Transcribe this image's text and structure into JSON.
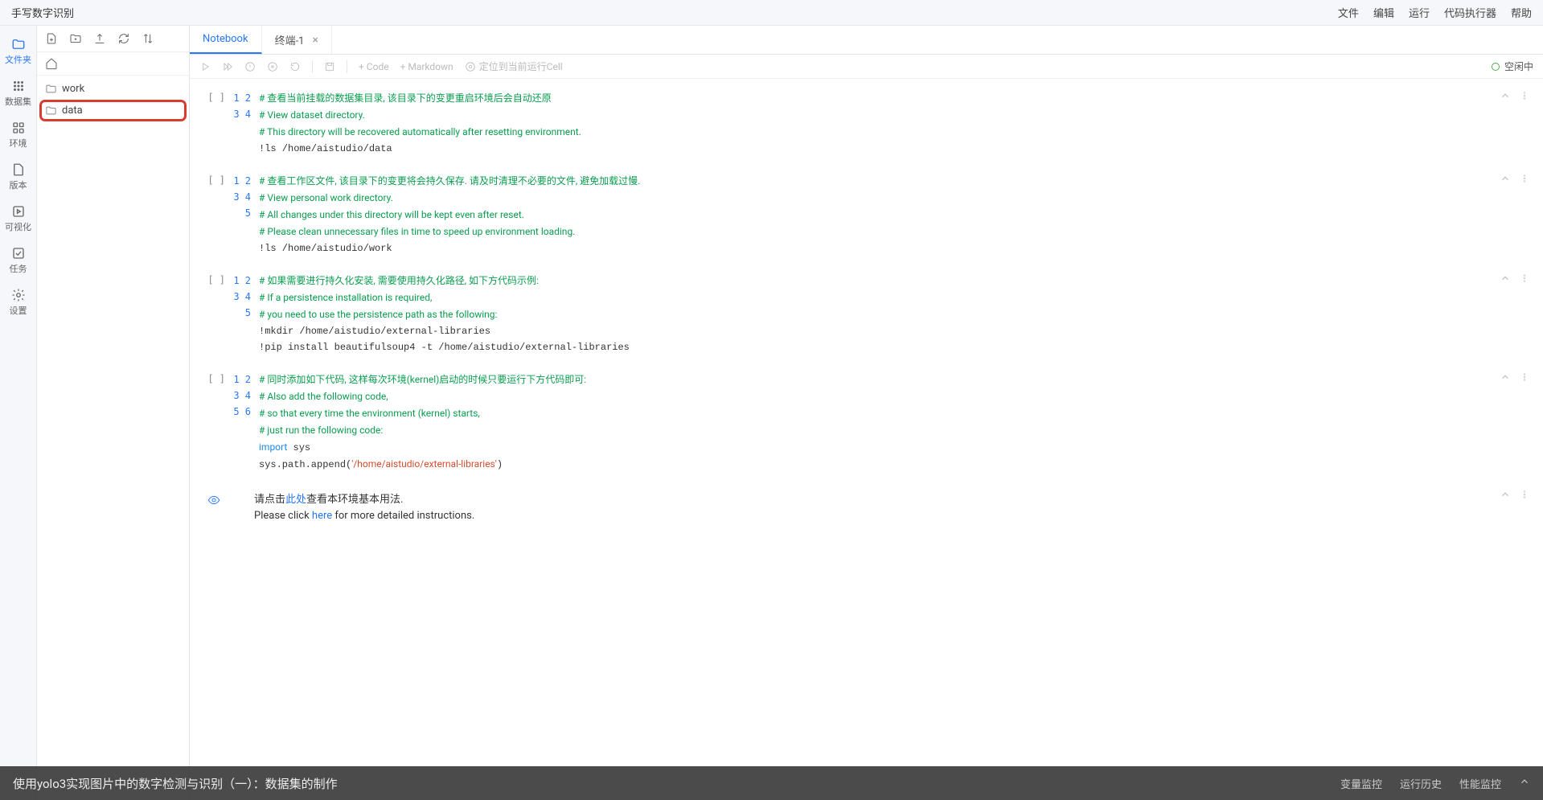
{
  "topbar": {
    "title": "手写数字识别",
    "menus": [
      "文件",
      "编辑",
      "运行",
      "代码执行器",
      "帮助"
    ]
  },
  "leftrail": {
    "items": [
      {
        "icon": "folder",
        "label": "文件夹",
        "active": true
      },
      {
        "icon": "grid",
        "label": "数据集"
      },
      {
        "icon": "apps",
        "label": "环境"
      },
      {
        "icon": "doc",
        "label": "版本"
      },
      {
        "icon": "play",
        "label": "可视化"
      },
      {
        "icon": "check",
        "label": "任务"
      },
      {
        "icon": "gear",
        "label": "设置"
      }
    ]
  },
  "filepanel": {
    "items": [
      {
        "name": "work",
        "highlighted": false
      },
      {
        "name": "data",
        "highlighted": true
      }
    ]
  },
  "tabs": [
    {
      "label": "Notebook",
      "active": true,
      "closable": false
    },
    {
      "label": "终端-1",
      "active": false,
      "closable": true
    }
  ],
  "nb_toolbar": {
    "add_code": "+ Code",
    "add_md": "+ Markdown",
    "goto": "定位到当前运行Cell",
    "status": "空闲中"
  },
  "cells": [
    {
      "prompt": "[ ]",
      "lines": [
        {
          "n": 1,
          "segs": [
            {
              "t": "comment",
              "v": "# 查看当前挂载的数据集目录, 该目录下的变更重启环境后会自动还原"
            }
          ]
        },
        {
          "n": 2,
          "segs": [
            {
              "t": "comment",
              "v": "# View dataset directory."
            }
          ]
        },
        {
          "n": 3,
          "segs": [
            {
              "t": "comment",
              "v": "# This directory will be recovered automatically after resetting environment."
            }
          ]
        },
        {
          "n": 4,
          "segs": [
            {
              "t": "plain",
              "v": "!ls /home/aistudio/data"
            }
          ]
        }
      ]
    },
    {
      "prompt": "[ ]",
      "lines": [
        {
          "n": 1,
          "segs": [
            {
              "t": "comment",
              "v": "# 查看工作区文件, 该目录下的变更将会持久保存. 请及时清理不必要的文件, 避免加载过慢."
            }
          ]
        },
        {
          "n": 2,
          "segs": [
            {
              "t": "comment",
              "v": "# View personal work directory."
            }
          ]
        },
        {
          "n": 3,
          "segs": [
            {
              "t": "comment",
              "v": "# All changes under this directory will be kept even after reset."
            }
          ]
        },
        {
          "n": 4,
          "segs": [
            {
              "t": "comment",
              "v": "# Please clean unnecessary files in time to speed up environment loading."
            }
          ]
        },
        {
          "n": 5,
          "segs": [
            {
              "t": "plain",
              "v": "!ls /home/aistudio/work"
            }
          ]
        }
      ]
    },
    {
      "prompt": "[ ]",
      "lines": [
        {
          "n": 1,
          "segs": [
            {
              "t": "comment",
              "v": "# 如果需要进行持久化安装, 需要使用持久化路径, 如下方代码示例:"
            }
          ]
        },
        {
          "n": 2,
          "segs": [
            {
              "t": "comment",
              "v": "# If a persistence installation is required,"
            }
          ]
        },
        {
          "n": 3,
          "segs": [
            {
              "t": "comment",
              "v": "# you need to use the persistence path as the following:"
            }
          ]
        },
        {
          "n": 4,
          "segs": [
            {
              "t": "plain",
              "v": "!mkdir /home/aistudio/external-libraries"
            }
          ]
        },
        {
          "n": 5,
          "segs": [
            {
              "t": "plain",
              "v": "!pip install beautifulsoup4 -t /home/aistudio/external-libraries"
            }
          ]
        }
      ]
    },
    {
      "prompt": "[ ]",
      "lines": [
        {
          "n": 1,
          "segs": [
            {
              "t": "comment",
              "v": "# 同时添加如下代码, 这样每次环境(kernel)启动的时候只要运行下方代码即可:"
            }
          ]
        },
        {
          "n": 2,
          "segs": [
            {
              "t": "comment",
              "v": "# Also add the following code,"
            }
          ]
        },
        {
          "n": 3,
          "segs": [
            {
              "t": "comment",
              "v": "# so that every time the environment (kernel) starts,"
            }
          ]
        },
        {
          "n": 4,
          "segs": [
            {
              "t": "comment",
              "v": "# just run the following code:"
            }
          ]
        },
        {
          "n": 5,
          "segs": [
            {
              "t": "kw",
              "v": "import"
            },
            {
              "t": "plain",
              "v": " sys"
            }
          ]
        },
        {
          "n": 6,
          "segs": [
            {
              "t": "plain",
              "v": "sys.path.append("
            },
            {
              "t": "str",
              "v": "'/home/aistudio/external-libraries'"
            },
            {
              "t": "plain",
              "v": ")"
            }
          ]
        }
      ]
    }
  ],
  "mdcell": {
    "line1_pre": "请点击",
    "line1_link": "此处",
    "line1_post": "查看本环境基本用法.",
    "line2_pre": "Please click ",
    "line2_link": "here",
    "line2_post": " for more detailed instructions."
  },
  "bottombar": {
    "title": "使用yolo3实现图片中的数字检测与识别（一）：数据集的制作",
    "right": [
      "变量监控",
      "运行历史",
      "性能监控"
    ]
  }
}
